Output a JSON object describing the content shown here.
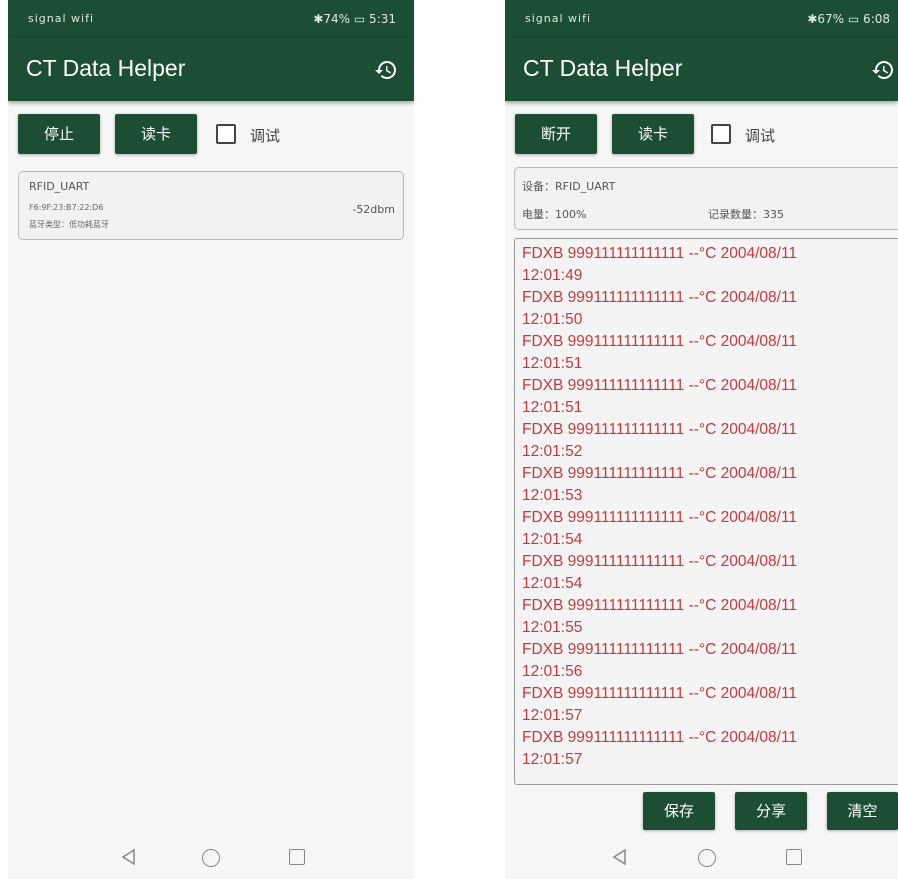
{
  "left": {
    "status": {
      "icons": "signal wifi",
      "right": "✱74% ▭ 5:31"
    },
    "title": "CT Data Helper",
    "buttons": {
      "stop": "停止",
      "read": "读卡"
    },
    "debug_label": "调试",
    "device": {
      "name": "RFID_UART",
      "mac": "F6:9F:23:B7:22:D6",
      "type": "蓝牙类型：低功耗蓝牙",
      "rssi": "-52dbm"
    }
  },
  "right": {
    "status": {
      "icons": "signal wifi",
      "right": "✱67% ▭ 6:08"
    },
    "title": "CT Data Helper",
    "buttons": {
      "disconnect": "断开",
      "read": "读卡"
    },
    "debug_label": "调试",
    "info": {
      "device": "设备：RFID_UART",
      "battery": "电量：100%",
      "count": "记录数量：335"
    },
    "log": [
      {
        "line1": "FDXB 999111111111111 --°C 2004/08/11",
        "line2": "12:01:49"
      },
      {
        "line1": "FDXB 999111111111111 --°C 2004/08/11",
        "line2": "12:01:50"
      },
      {
        "line1": "FDXB 999111111111111 --°C 2004/08/11",
        "line2": "12:01:51"
      },
      {
        "line1": "FDXB 999111111111111 --°C 2004/08/11",
        "line2": "12:01:51"
      },
      {
        "line1": "FDXB 999111111111111 --°C 2004/08/11",
        "line2": "12:01:52"
      },
      {
        "line1": "FDXB 999111111111111 --°C 2004/08/11",
        "line2": "12:01:53"
      },
      {
        "line1": "FDXB 999111111111111 --°C 2004/08/11",
        "line2": "12:01:54"
      },
      {
        "line1": "FDXB 999111111111111 --°C 2004/08/11",
        "line2": "12:01:54"
      },
      {
        "line1": "FDXB 999111111111111 --°C 2004/08/11",
        "line2": "12:01:55"
      },
      {
        "line1": "FDXB 999111111111111 --°C 2004/08/11",
        "line2": "12:01:56"
      },
      {
        "line1": "FDXB 999111111111111 --°C 2004/08/11",
        "line2": "12:01:57"
      },
      {
        "line1": "FDXB 999111111111111 --°C 2004/08/11",
        "line2": "12:01:57"
      }
    ],
    "bottom_buttons": {
      "save": "保存",
      "share": "分享",
      "clear": "清空"
    }
  }
}
